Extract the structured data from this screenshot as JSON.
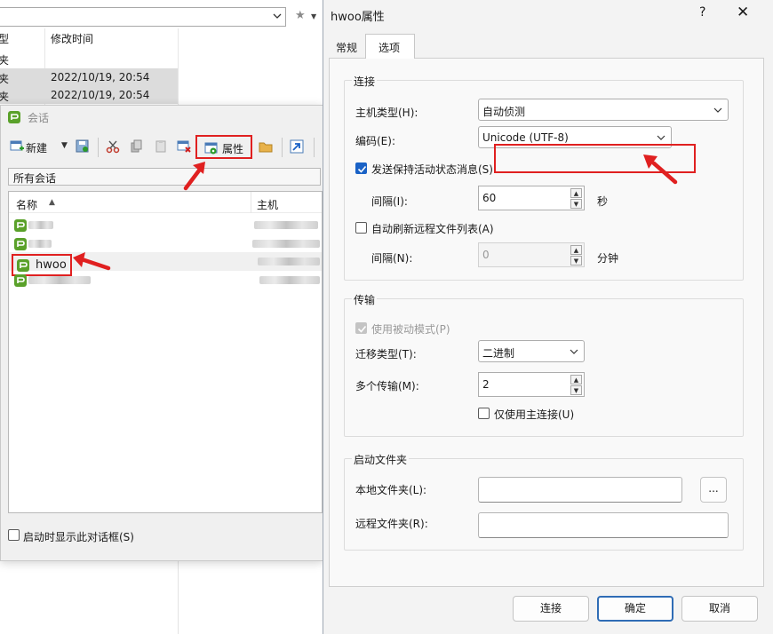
{
  "background": {
    "col_type": "型",
    "col_modified": "修改时间",
    "rows": [
      {
        "type": "夹",
        "modified": ""
      },
      {
        "type": "夹",
        "modified": "2022/10/19, 20:54"
      },
      {
        "type": "夹",
        "modified": "2022/10/19, 20:54"
      }
    ]
  },
  "sessions": {
    "title": "会话",
    "toolbar": {
      "new_label": "新建",
      "properties_label": "属性"
    },
    "tree_root": "所有会话",
    "columns": {
      "name": "名称",
      "host": "主机"
    },
    "items": [
      {
        "name": "",
        "blurred": true
      },
      {
        "name": "",
        "blurred": true
      },
      {
        "name": "hwoo",
        "blurred": false
      },
      {
        "name": "",
        "blurred": true
      }
    ],
    "show_on_startup_label": "启动时显示此对话框(S)"
  },
  "properties": {
    "title": "hwoo属性",
    "help": "?",
    "tabs": {
      "general": "常规",
      "options": "选项"
    },
    "connection": {
      "group_title": "连接",
      "host_type_label": "主机类型(H):",
      "host_type_value": "自动侦测",
      "encoding_label": "编码(E):",
      "encoding_value": "Unicode (UTF-8)",
      "keepalive_label": "发送保持活动状态消息(S)",
      "interval_label": "间隔(I):",
      "interval_value": "60",
      "interval_unit": "秒",
      "auto_refresh_label": "自动刷新远程文件列表(A)",
      "refresh_interval_label": "间隔(N):",
      "refresh_interval_value": "0",
      "refresh_interval_unit": "分钟"
    },
    "transfer": {
      "group_title": "传输",
      "passive_label": "使用被动模式(P)",
      "transfer_type_label": "迁移类型(T):",
      "transfer_type_value": "二进制",
      "multi_label": "多个传输(M):",
      "multi_value": "2",
      "primary_only_label": "仅使用主连接(U)"
    },
    "startup": {
      "group_title": "启动文件夹",
      "local_label": "本地文件夹(L):",
      "local_value": "",
      "browse_label": "...",
      "remote_label": "远程文件夹(R):",
      "remote_value": ""
    },
    "buttons": {
      "connect": "连接",
      "ok": "确定",
      "cancel": "取消"
    }
  },
  "colors": {
    "accent": "#1a62c6",
    "highlight": "#e02020",
    "app_icon": "#5aa12a"
  }
}
